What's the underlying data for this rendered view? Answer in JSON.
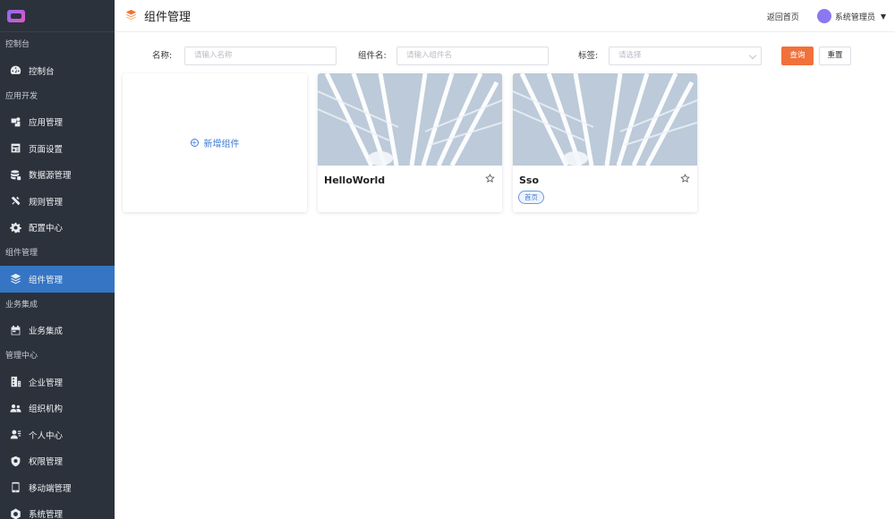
{
  "sidebar": {
    "groups": [
      {
        "title": "控制台",
        "items": [
          {
            "label": "控制台",
            "icon": "dashboard-icon"
          }
        ]
      },
      {
        "title": "应用开发",
        "items": [
          {
            "label": "应用管理",
            "icon": "app-icon"
          },
          {
            "label": "页面设置",
            "icon": "page-icon"
          },
          {
            "label": "数据源管理",
            "icon": "database-icon"
          },
          {
            "label": "规则管理",
            "icon": "rule-icon"
          },
          {
            "label": "配置中心",
            "icon": "gear-icon"
          }
        ]
      },
      {
        "title": "组件管理",
        "items": [
          {
            "label": "组件管理",
            "icon": "layers-icon",
            "active": true
          }
        ]
      },
      {
        "title": "业务集成",
        "items": [
          {
            "label": "业务集成",
            "icon": "calendar-icon"
          }
        ]
      },
      {
        "title": "管理中心",
        "items": [
          {
            "label": "企业管理",
            "icon": "building-icon"
          },
          {
            "label": "组织机构",
            "icon": "org-icon"
          },
          {
            "label": "个人中心",
            "icon": "user-card-icon"
          },
          {
            "label": "权限管理",
            "icon": "shield-icon"
          },
          {
            "label": "移动端管理",
            "icon": "mobile-icon"
          },
          {
            "label": "系统管理",
            "icon": "settings-icon"
          }
        ]
      }
    ]
  },
  "header": {
    "title": "组件管理",
    "home_link": "返回首页",
    "user_name": "系统管理员"
  },
  "filters": {
    "name_label": "名称:",
    "name_placeholder": "请输入名称",
    "component_label": "组件名:",
    "component_placeholder": "请输入组件名",
    "tag_label": "标签:",
    "tag_placeholder": "请选择",
    "search_button": "查询",
    "reset_button": "重置"
  },
  "cards": {
    "add_label": "新增组件",
    "items": [
      {
        "title": "HelloWorld",
        "tags": []
      },
      {
        "title": "Sso",
        "tags": [
          "首页"
        ]
      }
    ]
  },
  "colors": {
    "sidebar_bg": "#2b323c",
    "active_item": "#3575c4",
    "primary_button": "#f1713a",
    "link_blue": "#3d7bd4"
  }
}
